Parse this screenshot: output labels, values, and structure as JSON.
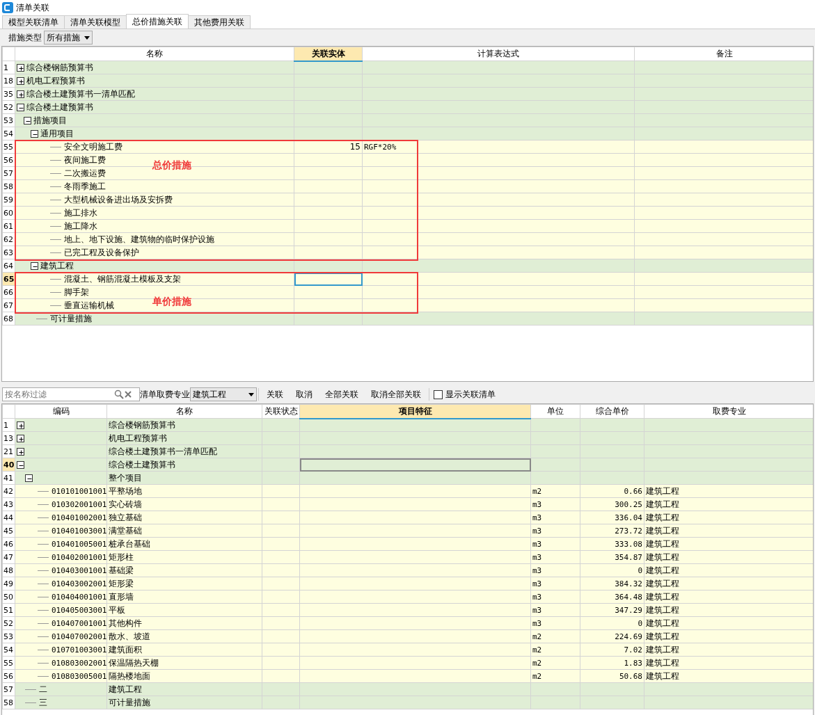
{
  "window": {
    "title": "清单关联"
  },
  "tabs": [
    {
      "label": "模型关联清单",
      "selected": false
    },
    {
      "label": "清单关联模型",
      "selected": false
    },
    {
      "label": "总价措施关联",
      "selected": true
    },
    {
      "label": "其他费用关联",
      "selected": false
    }
  ],
  "filter": {
    "label": "措施类型",
    "value": "所有措施"
  },
  "top_table": {
    "columns": [
      {
        "label": "名称",
        "selected": false
      },
      {
        "label": "关联实体",
        "selected": true
      },
      {
        "label": "计算表达式",
        "selected": false
      },
      {
        "label": "备注",
        "selected": false
      }
    ],
    "rows": [
      {
        "num": "1",
        "name": "综合楼钢筋预算书",
        "kind": "group",
        "expanded": false,
        "selected": false,
        "in_box": false
      },
      {
        "num": "18",
        "name": "机电工程预算书",
        "kind": "group",
        "expanded": false,
        "selected": false,
        "in_box": false
      },
      {
        "num": "35",
        "name": "综合楼土建预算书一清单匹配",
        "kind": "group",
        "expanded": false,
        "selected": false,
        "in_box": false
      },
      {
        "num": "52",
        "name": "综合楼土建预算书",
        "kind": "group",
        "expanded": true,
        "selected": false,
        "in_box": false,
        "children": [
          {
            "num": "53",
            "name": "措施项目",
            "kind": "group",
            "expanded": true,
            "selected": false,
            "in_box": false,
            "children": [
              {
                "num": "54",
                "name": "通用项目",
                "kind": "group",
                "expanded": true,
                "selected": false,
                "in_box": false,
                "children": [
                  {
                    "num": "55",
                    "name": "安全文明施工费",
                    "kind": "item",
                    "selected": false,
                    "in_box": true,
                    "entity": "15",
                    "expression": "RGF*20%"
                  },
                  {
                    "num": "56",
                    "name": "夜间施工费",
                    "kind": "item",
                    "selected": false,
                    "in_box": true
                  },
                  {
                    "num": "57",
                    "name": "二次搬运费",
                    "kind": "item",
                    "selected": false,
                    "in_box": true
                  },
                  {
                    "num": "58",
                    "name": "冬雨季施工",
                    "kind": "item",
                    "selected": false,
                    "in_box": true
                  },
                  {
                    "num": "59",
                    "name": "大型机械设备进出场及安拆费",
                    "kind": "item",
                    "selected": false,
                    "in_box": true
                  },
                  {
                    "num": "60",
                    "name": "施工排水",
                    "kind": "item",
                    "selected": false,
                    "in_box": true
                  },
                  {
                    "num": "61",
                    "name": "施工降水",
                    "kind": "item",
                    "selected": false,
                    "in_box": true
                  },
                  {
                    "num": "62",
                    "name": "地上、地下设施、建筑物的临时保护设施",
                    "kind": "item",
                    "selected": false,
                    "in_box": true
                  },
                  {
                    "num": "63",
                    "name": "已完工程及设备保护",
                    "kind": "item",
                    "selected": false,
                    "in_box": true
                  }
                ]
              },
              {
                "num": "64",
                "name": "建筑工程",
                "kind": "group",
                "expanded": true,
                "selected": false,
                "in_box": false,
                "children": [
                  {
                    "num": "65",
                    "name": "混凝土、钢筋混凝土模板及支架",
                    "kind": "item",
                    "selected": true,
                    "in_box": true
                  },
                  {
                    "num": "66",
                    "name": "脚手架",
                    "kind": "item",
                    "selected": false,
                    "in_box": true
                  },
                  {
                    "num": "67",
                    "name": "垂直运输机械",
                    "kind": "item",
                    "selected": false,
                    "in_box": true
                  }
                ]
              },
              {
                "num": "68",
                "name": "可计量措施",
                "kind": "group",
                "selected": false,
                "in_box": false
              }
            ]
          }
        ]
      }
    ]
  },
  "annotations": [
    {
      "label": "总价措施"
    },
    {
      "label": "单价措施"
    }
  ],
  "toolbar": {
    "search_placeholder": "按名称过滤",
    "fee_label": "清单取费专业",
    "fee_value": "建筑工程",
    "buttons": [
      "关联",
      "取消",
      "全部关联",
      "取消全部关联"
    ],
    "show_linked": {
      "label": "显示关联清单",
      "checked": false
    }
  },
  "bottom_table": {
    "columns": [
      {
        "label": "编码",
        "selected": false
      },
      {
        "label": "名称",
        "selected": false
      },
      {
        "label": "关联状态",
        "selected": false
      },
      {
        "label": "项目特征",
        "selected": true
      },
      {
        "label": "单位",
        "selected": false
      },
      {
        "label": "综合单价",
        "selected": false
      },
      {
        "label": "取费专业",
        "selected": false
      }
    ],
    "rows": [
      {
        "num": "1",
        "name": "综合楼钢筋预算书",
        "kind": "group",
        "expanded": false,
        "selected": false
      },
      {
        "num": "13",
        "name": "机电工程预算书",
        "kind": "group",
        "expanded": false,
        "selected": false
      },
      {
        "num": "21",
        "name": "综合楼土建预算书一清单匹配",
        "kind": "group",
        "expanded": false,
        "selected": false
      },
      {
        "num": "40",
        "name": "综合楼土建预算书",
        "kind": "group",
        "expanded": true,
        "selected": true,
        "children": [
          {
            "num": "41",
            "name": "整个项目",
            "kind": "group",
            "expanded": true,
            "selected": false,
            "children": [
              {
                "num": "42",
                "code": "010101001001",
                "name": "平整场地",
                "kind": "item",
                "selected": false,
                "unit": "m2",
                "price": "0.66",
                "fee": "建筑工程"
              },
              {
                "num": "43",
                "code": "010302001001",
                "name": "实心砖墙",
                "kind": "item",
                "selected": false,
                "unit": "m3",
                "price": "300.25",
                "fee": "建筑工程"
              },
              {
                "num": "44",
                "code": "010401002001",
                "name": "独立基础",
                "kind": "item",
                "selected": false,
                "unit": "m3",
                "price": "336.04",
                "fee": "建筑工程"
              },
              {
                "num": "45",
                "code": "010401003001",
                "name": "满堂基础",
                "kind": "item",
                "selected": false,
                "unit": "m3",
                "price": "273.72",
                "fee": "建筑工程"
              },
              {
                "num": "46",
                "code": "010401005001",
                "name": "桩承台基础",
                "kind": "item",
                "selected": false,
                "unit": "m3",
                "price": "333.08",
                "fee": "建筑工程"
              },
              {
                "num": "47",
                "code": "010402001001",
                "name": "矩形柱",
                "kind": "item",
                "selected": false,
                "unit": "m3",
                "price": "354.87",
                "fee": "建筑工程"
              },
              {
                "num": "48",
                "code": "010403001001",
                "name": "基础梁",
                "kind": "item",
                "selected": false,
                "unit": "m3",
                "price": "0",
                "fee": "建筑工程"
              },
              {
                "num": "49",
                "code": "010403002001",
                "name": "矩形梁",
                "kind": "item",
                "selected": false,
                "unit": "m3",
                "price": "384.32",
                "fee": "建筑工程"
              },
              {
                "num": "50",
                "code": "010404001001",
                "name": "直形墙",
                "kind": "item",
                "selected": false,
                "unit": "m3",
                "price": "364.48",
                "fee": "建筑工程"
              },
              {
                "num": "51",
                "code": "010405003001",
                "name": "平板",
                "kind": "item",
                "selected": false,
                "unit": "m3",
                "price": "347.29",
                "fee": "建筑工程"
              },
              {
                "num": "52",
                "code": "010407001001",
                "name": "其他构件",
                "kind": "item",
                "selected": false,
                "unit": "m3",
                "price": "0",
                "fee": "建筑工程"
              },
              {
                "num": "53",
                "code": "010407002001",
                "name": "散水、坡道",
                "kind": "item",
                "selected": false,
                "unit": "m2",
                "price": "224.69",
                "fee": "建筑工程"
              },
              {
                "num": "54",
                "code": "010701003001",
                "name": "建筑面积",
                "kind": "item",
                "selected": false,
                "unit": "m2",
                "price": "7.02",
                "fee": "建筑工程"
              },
              {
                "num": "55",
                "code": "010803002001",
                "name": "保温隔热天棚",
                "kind": "item",
                "selected": false,
                "unit": "m2",
                "price": "1.83",
                "fee": "建筑工程"
              },
              {
                "num": "56",
                "code": "010803005001",
                "name": "隔热楼地面",
                "kind": "item",
                "selected": false,
                "unit": "m2",
                "price": "50.68",
                "fee": "建筑工程"
              }
            ]
          },
          {
            "num": "57",
            "code": "二",
            "name": "建筑工程",
            "kind": "group",
            "selected": false
          },
          {
            "num": "58",
            "code": "三",
            "name": "可计量措施",
            "kind": "group",
            "selected": false
          }
        ]
      }
    ]
  }
}
